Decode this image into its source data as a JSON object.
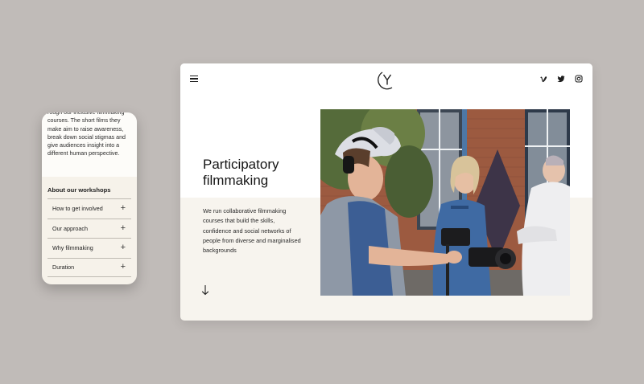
{
  "phone": {
    "intro_text": "rough our inclusive filmmaking courses. The short films they make aim to raise awareness, break down social stigmas and give audiences insight into a different human perspective.",
    "workshops_heading": "About our workshops",
    "accordion": [
      {
        "label": "How to get involved"
      },
      {
        "label": "Our approach"
      },
      {
        "label": "Why filmmaking"
      },
      {
        "label": "Duration"
      }
    ],
    "plus_glyph": "+"
  },
  "desktop": {
    "hero_title": "Participatory filmmaking",
    "hero_copy": "We run collaborative filmmaking courses that build the skills, confidence and social networks of people from diverse and marginalised backgrounds",
    "icons": [
      "menu-icon",
      "logo-icon",
      "vimeo-icon",
      "twitter-icon",
      "instagram-icon",
      "arrow-down-icon"
    ]
  },
  "colors": {
    "background": "#c0bbb8",
    "panel": "#f7f4ee",
    "panel_white": "#ffffff",
    "text": "#1e1e1e"
  }
}
